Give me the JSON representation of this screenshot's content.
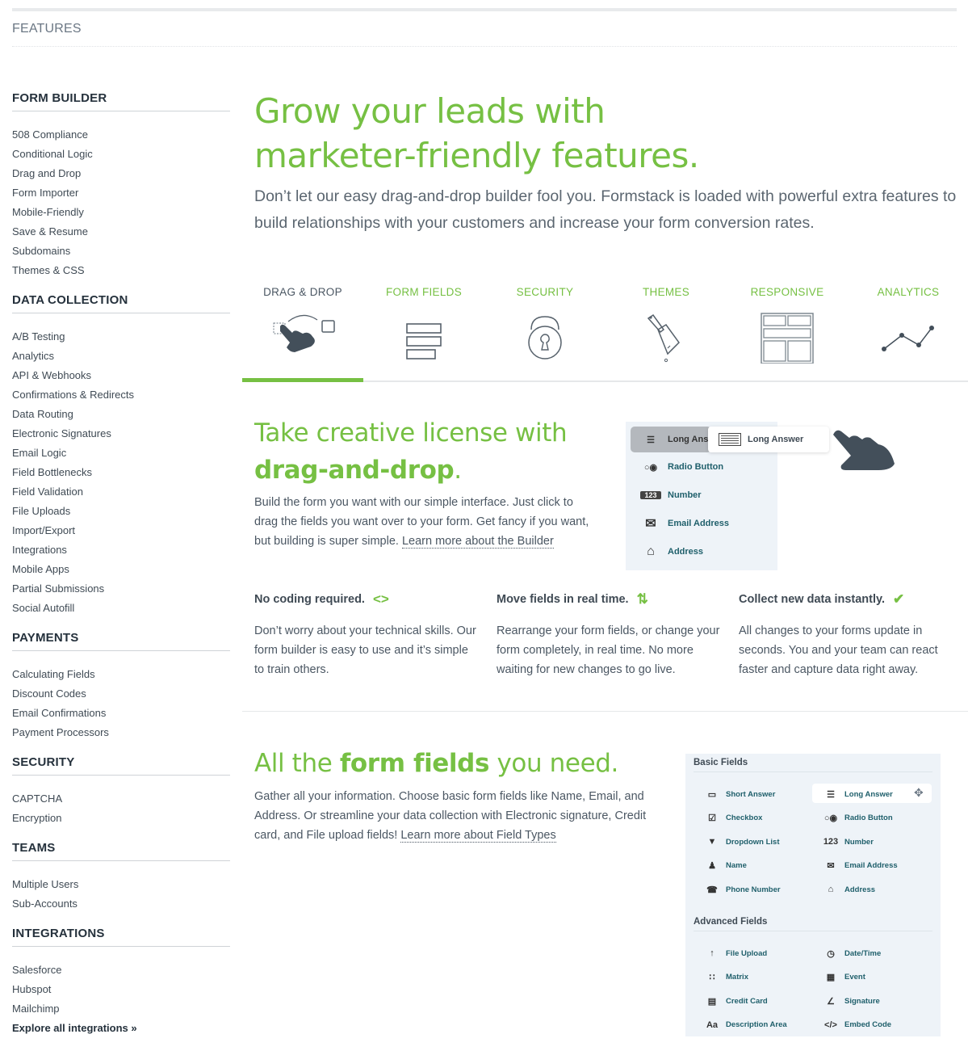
{
  "page": {
    "label": "FEATURES"
  },
  "sidebar": {
    "sections": [
      {
        "heading": "FORM BUILDER",
        "items": [
          "508 Compliance",
          "Conditional Logic",
          "Drag and Drop",
          "Form Importer",
          "Mobile-Friendly",
          "Save & Resume",
          "Subdomains",
          "Themes & CSS"
        ]
      },
      {
        "heading": "DATA COLLECTION",
        "items": [
          "A/B Testing",
          "Analytics",
          "API & Webhooks",
          "Confirmations & Redirects",
          "Data Routing",
          "Electronic Signatures",
          "Email Logic",
          "Field Bottlenecks",
          "Field Validation",
          "File Uploads",
          "Import/Export",
          "Integrations",
          "Mobile Apps",
          "Partial Submissions",
          "Social Autofill"
        ]
      },
      {
        "heading": "PAYMENTS",
        "items": [
          "Calculating Fields",
          "Discount Codes",
          "Email Confirmations",
          "Payment Processors"
        ]
      },
      {
        "heading": "SECURITY",
        "items": [
          "CAPTCHA",
          "Encryption"
        ]
      },
      {
        "heading": "TEAMS",
        "items": [
          "Multiple Users",
          "Sub-Accounts"
        ]
      },
      {
        "heading": "INTEGRATIONS",
        "items": [
          "Salesforce",
          "Hubspot",
          "Mailchimp"
        ],
        "explore": "Explore all integrations »"
      }
    ]
  },
  "hero": {
    "title_line1": "Grow your leads with",
    "title_line2": "marketer-friendly features.",
    "subtitle": "Don’t let our easy drag-and-drop builder fool you. Formstack is loaded with powerful extra features to build relationships with your customers and increase your form conversion rates."
  },
  "tabs": [
    {
      "label": "DRAG & DROP",
      "icon": "drag-hand-icon",
      "active": true
    },
    {
      "label": "FORM FIELDS",
      "icon": "form-fields-icon",
      "active": false
    },
    {
      "label": "SECURITY",
      "icon": "lock-icon",
      "active": false
    },
    {
      "label": "THEMES",
      "icon": "paintbrush-icon",
      "active": false
    },
    {
      "label": "RESPONSIVE",
      "icon": "layout-grid-icon",
      "active": false
    },
    {
      "label": "ANALYTICS",
      "icon": "line-chart-icon",
      "active": false
    }
  ],
  "colors": {
    "accent": "#76c043",
    "text": "#4b5763",
    "heading": "#25313c",
    "panel": "#eef3f8",
    "field_label": "#1f5f6b"
  },
  "drag_section": {
    "title_plain": "Take creative license with",
    "title_bold": "drag-and-drop",
    "title_end": ".",
    "body": "Build the form you want with our simple interface. Just click to drag the fields you want over to your form. Get fancy if you want, but building is super simple. ",
    "link": "Learn more about the Builder",
    "demo": {
      "ghost_label": "Long Ans",
      "float_label": "Long Answer",
      "items": [
        "Radio Button",
        "Number",
        "Email Address",
        "Address"
      ]
    }
  },
  "features": [
    {
      "title": "No coding required.",
      "icon": "code-brackets-icon",
      "glyph": "<>",
      "body": "Don’t worry about your technical skills. Our form builder is easy to use and it’s simple to train others."
    },
    {
      "title": "Move fields in real time.",
      "icon": "swap-arrows-icon",
      "glyph": "⇅",
      "body": "Rearrange your form fields, or change your form completely, in real time. No more waiting for new changes to go live."
    },
    {
      "title": "Collect new data instantly.",
      "icon": "checkmark-icon",
      "glyph": "✔",
      "body": "All changes to your forms update in seconds. You and your team can react faster and capture data right away."
    }
  ],
  "fields_section": {
    "title_start": "All the ",
    "title_bold": "form fields",
    "title_end": " you need.",
    "body": "Gather all your information. Choose basic form fields like Name, Email, and Address. Or streamline your data collection with Electronic signature, Credit card, and File upload fields! ",
    "link": "Learn more about Field Types",
    "basic_heading": "Basic Fields",
    "basic_left": [
      {
        "label": "Short Answer",
        "icon": "short-answer-icon",
        "glyph": "▭"
      },
      {
        "label": "Checkbox",
        "icon": "checkbox-icon",
        "glyph": "☑"
      },
      {
        "label": "Dropdown List",
        "icon": "dropdown-icon",
        "glyph": "▼"
      },
      {
        "label": "Name",
        "icon": "person-icon",
        "glyph": "♟"
      },
      {
        "label": "Phone Number",
        "icon": "phone-icon",
        "glyph": "☎"
      }
    ],
    "basic_right": [
      {
        "label": "Long Answer",
        "icon": "long-answer-icon",
        "glyph": "☰"
      },
      {
        "label": "Radio Button",
        "icon": "radio-icon",
        "glyph": "○◉"
      },
      {
        "label": "Number",
        "icon": "number-icon",
        "glyph": "123"
      },
      {
        "label": "Email Address",
        "icon": "envelope-icon",
        "glyph": "✉"
      },
      {
        "label": "Address",
        "icon": "house-icon",
        "glyph": "⌂"
      }
    ],
    "advanced_heading": "Advanced Fields",
    "advanced_left": [
      {
        "label": "File Upload",
        "icon": "upload-icon",
        "glyph": "↑"
      },
      {
        "label": "Matrix",
        "icon": "matrix-icon",
        "glyph": "∷"
      },
      {
        "label": "Credit Card",
        "icon": "credit-card-icon",
        "glyph": "▤"
      },
      {
        "label": "Description Area",
        "icon": "text-icon",
        "glyph": "Aa"
      }
    ],
    "advanced_right": [
      {
        "label": "Date/Time",
        "icon": "clock-icon",
        "glyph": "◷"
      },
      {
        "label": "Event",
        "icon": "calendar-icon",
        "glyph": "▦"
      },
      {
        "label": "Signature",
        "icon": "signature-icon",
        "glyph": "∠"
      },
      {
        "label": "Embed Code",
        "icon": "embed-code-icon",
        "glyph": "</>"
      }
    ]
  }
}
